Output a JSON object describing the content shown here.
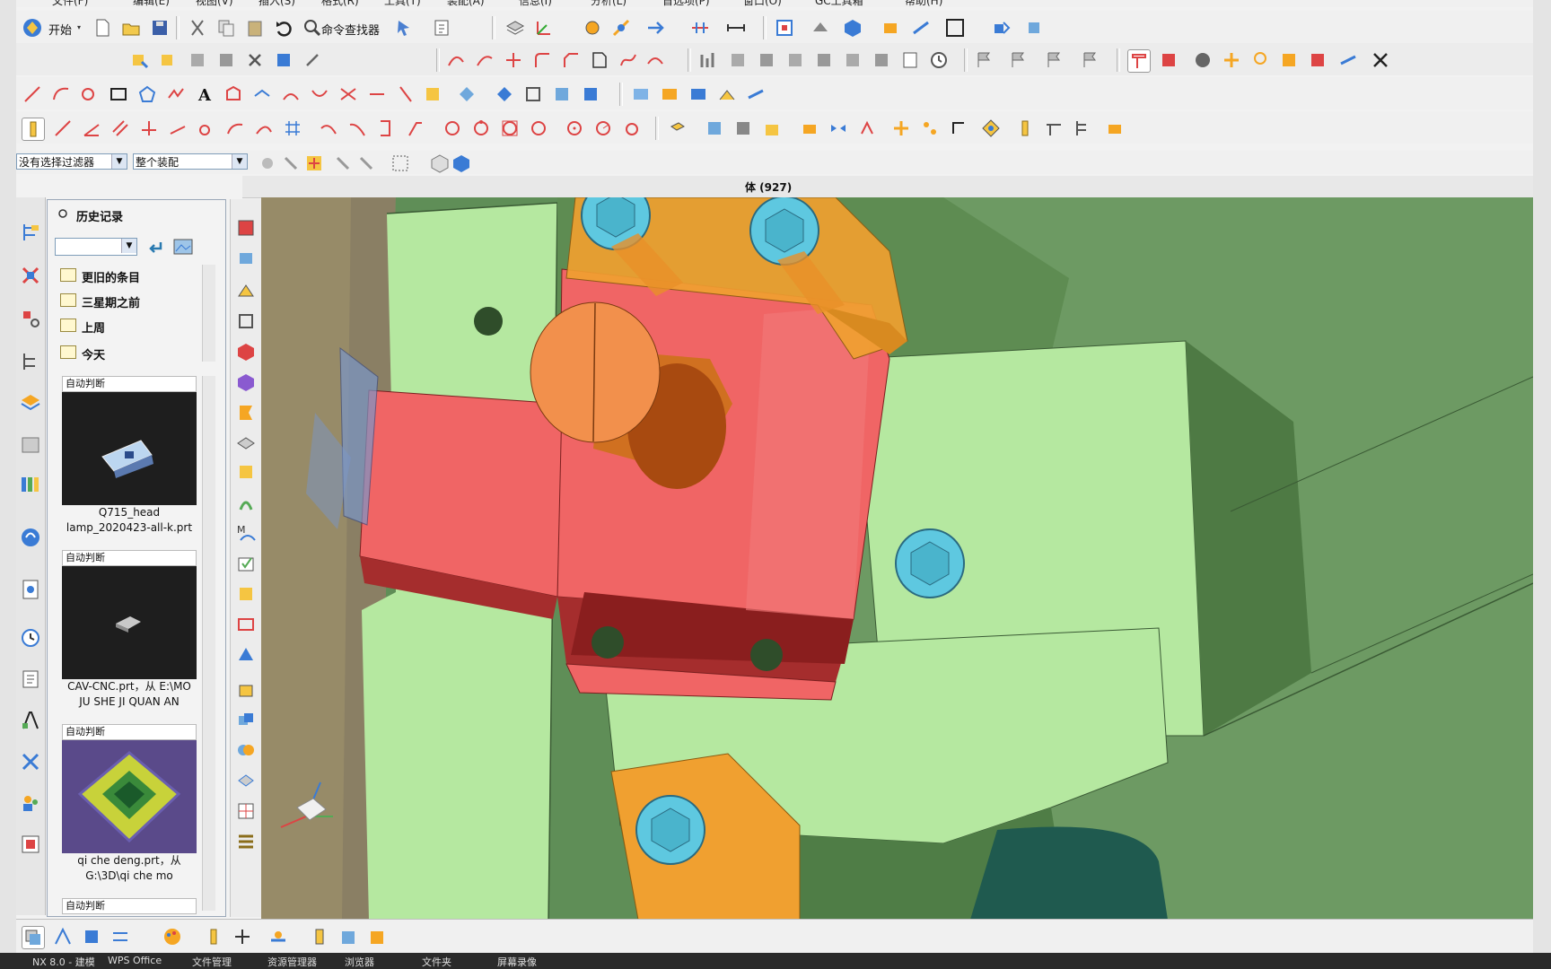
{
  "menubar": {
    "items": [
      "文件(F)",
      "编辑(E)",
      "视图(V)",
      "插入(S)",
      "格式(R)",
      "工具(T)",
      "装配(A)",
      "信息(I)",
      "分析(L)",
      "首选项(P)",
      "窗口(O)",
      "GC工具箱",
      "帮助(H)"
    ]
  },
  "toolbar": {
    "start_label": "开始",
    "command_finder_label": "命令查找器"
  },
  "filterbar": {
    "selection_filter": "没有选择过滤器",
    "scope": "整个装配"
  },
  "viewport": {
    "title": "体 (927)"
  },
  "history": {
    "title": "历史记录",
    "folders": [
      {
        "label": "更旧的条目"
      },
      {
        "label": "三星期之前"
      },
      {
        "label": "上周"
      },
      {
        "label": "今天"
      }
    ],
    "cards": [
      {
        "header": "自动判断",
        "caption_line1": "Q715_head",
        "caption_line2": "lamp_2020423-all-k.prt"
      },
      {
        "header": "自动判断",
        "caption_line1": "CAV-CNC.prt，从 E:\\MO",
        "caption_line2": "JU SHE JI QUAN AN"
      },
      {
        "header": "自动判断",
        "caption_line1": "qi che deng.prt，从",
        "caption_line2": "G:\\3D\\qi che mo"
      },
      {
        "header": "自动判断"
      }
    ]
  },
  "taskbar": {
    "items": [
      "NX 8.0 - 建模",
      "WPS Office",
      "文件管理",
      "资源管理器",
      "浏览器",
      "文件夹",
      "屏幕录像"
    ]
  },
  "colors": {
    "viewport_bg": "#6d9a63",
    "light_green": "#b5e8a0",
    "red_part": "#f06565",
    "orange_part": "#f0a030",
    "bolt_cyan": "#5ec8e0"
  }
}
